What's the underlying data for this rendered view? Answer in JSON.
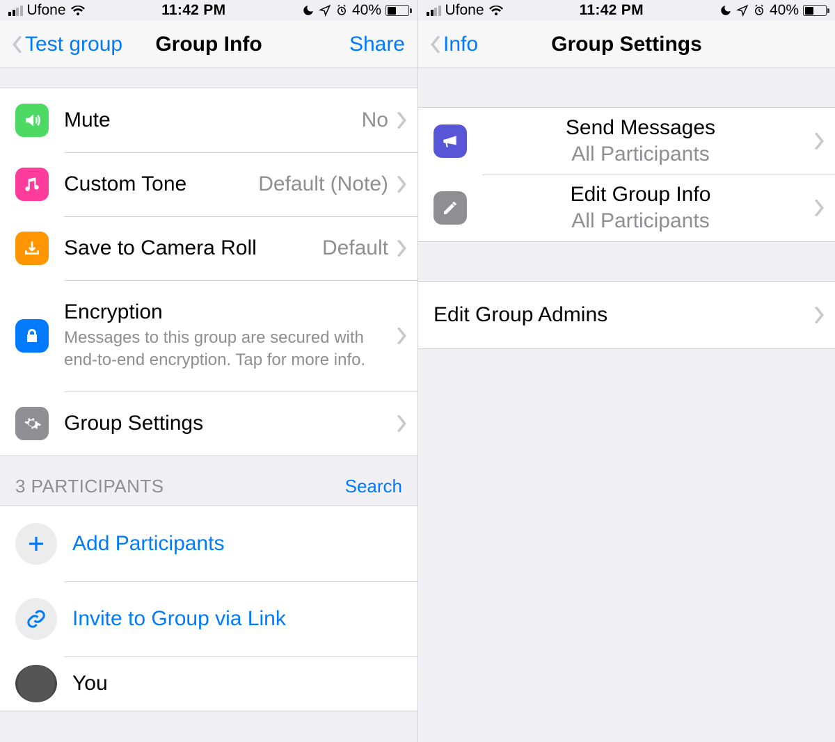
{
  "statusbar": {
    "carrier": "Ufone",
    "time": "11:42 PM",
    "battery_pct": "40%"
  },
  "left": {
    "nav": {
      "back_label": "Test group",
      "title": "Group Info",
      "action_label": "Share"
    },
    "cells": {
      "mute": {
        "label": "Mute",
        "value": "No"
      },
      "tone": {
        "label": "Custom Tone",
        "value": "Default (Note)"
      },
      "camera": {
        "label": "Save to Camera Roll",
        "value": "Default"
      },
      "encryption": {
        "label": "Encryption",
        "sub": "Messages to this group are secured with end-to-end encryption. Tap for more info."
      },
      "settings": {
        "label": "Group Settings"
      }
    },
    "participants": {
      "header": "3 PARTICIPANTS",
      "search": "Search",
      "add": "Add Participants",
      "invite": "Invite to Group via Link",
      "you": "You"
    }
  },
  "right": {
    "nav": {
      "back_label": "Info",
      "title": "Group Settings"
    },
    "cells": {
      "send": {
        "label": "Send Messages",
        "value": "All Participants"
      },
      "edit": {
        "label": "Edit Group Info",
        "value": "All Participants"
      },
      "admins": {
        "label": "Edit Group Admins"
      }
    }
  }
}
